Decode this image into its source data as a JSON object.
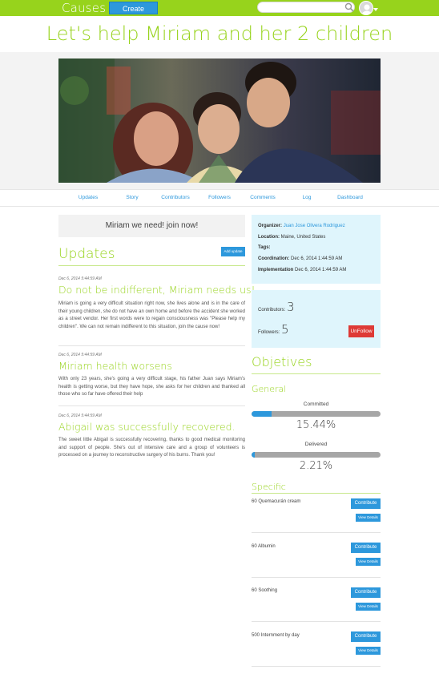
{
  "topbar": {
    "brand": "Causes",
    "create_label": "Create",
    "search": {
      "value": "",
      "placeholder": ""
    }
  },
  "page_title": "Let's help Miriam and her 2 children",
  "nav": [
    "Updates",
    "Story",
    "Contributors",
    "Followers",
    "Comments",
    "Log",
    "Dashboard"
  ],
  "join_text": "Miriam we need! join now!",
  "updates": {
    "heading": "Updates",
    "add_label": "Add update",
    "items": [
      {
        "date": "Dec 6, 2014 5:44:59 AM",
        "title": "Do not be indifferent, Miriam needs us!",
        "body": "Miriam is going a very difficult situation right now, she lives alone and is in the care of their young children, she do not have an own home and before the accident she worked as a street vendor. Her first words were to regain consciousness was \"Please help my children\". We can not remain indifferent to this situation, join the cause now!"
      },
      {
        "date": "Dec 6, 2014 5:44:59 AM",
        "title": "Miriam health worsens",
        "body": "With only 23 years, she's going a very difficult stage, his father Juan says Miriam's health is getting worse, but they have hope, she asks for her children and thanked all those who so far have offered their help"
      },
      {
        "date": "Dec 6, 2014 5:44:59 AM",
        "title": "Abigail was successfully recovered.",
        "body": "The sweet little Abigail is successfully recovering, thanks to good medical monitoring and support of people. She's out of intensive care and a group of volunteers is processed on a journey to reconstructive surgery of his burns. Thank you!"
      }
    ]
  },
  "info": {
    "organizer_label": "Organizer:",
    "organizer_value": "Juan Jose Olivera Rodriguez",
    "location_label": "Location:",
    "location_value": "Maine, United States",
    "tags_label": "Tags:",
    "coordination_label": "Coordination:",
    "coordination_value": "Dec 6, 2014 1:44:59 AM",
    "implementation_label": "Implementation",
    "implementation_value": "Dec 6, 2014 1:44:59 AM"
  },
  "stats": {
    "contributors_label": "Contributors:",
    "contributors_value": "3",
    "followers_label": "Followers:",
    "followers_value": "5",
    "unfollow_label": "UnFollow"
  },
  "objectives": {
    "heading": "Objetives",
    "general_heading": "General",
    "committed": {
      "label": "Committed",
      "percent_text": "15.44%",
      "fraction": 0.1544
    },
    "delivered": {
      "label": "Delivered",
      "percent_text": "2.21%",
      "fraction": 0.0221
    },
    "specific_heading": "Specific",
    "contribute_label": "Contribute",
    "details_label": "View Details",
    "items": [
      "60 Quemacurán cream",
      "60 Albumin",
      "60 Soothing",
      "500 Internment by day"
    ]
  },
  "colors": {
    "accent_green": "#97d31c",
    "accent_blue": "#2d98dc",
    "danger_red": "#de3a36"
  },
  "icons": [
    "search-icon",
    "avatar-icon",
    "chevron-down-icon"
  ]
}
